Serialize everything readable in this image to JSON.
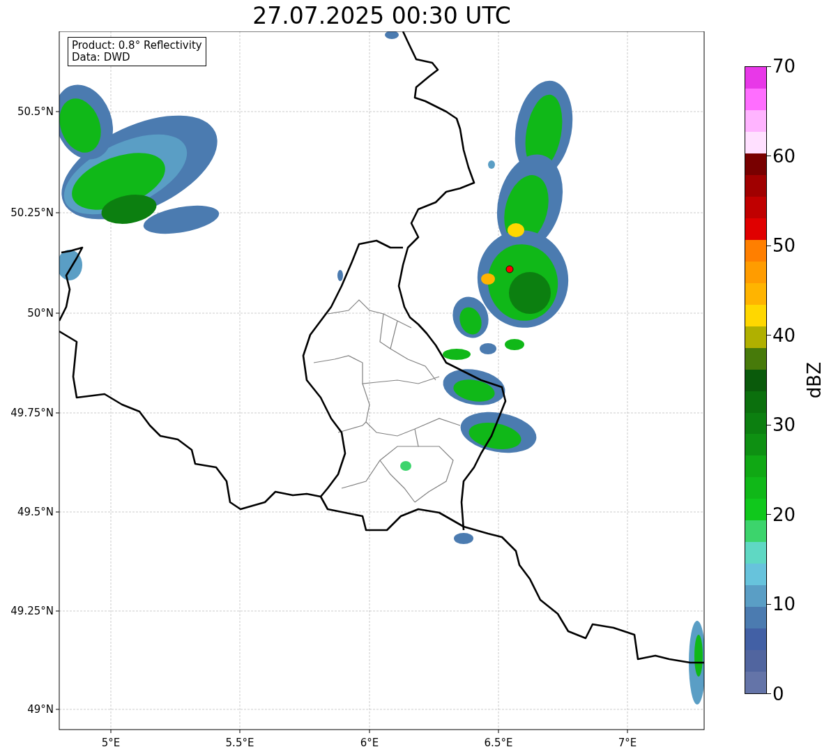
{
  "title": "27.07.2025 00:30 UTC",
  "info_box": [
    "Product: 0.8° Reflectivity",
    "Data: DWD"
  ],
  "map": {
    "x_ticks": [
      "5°E",
      "5.5°E",
      "6°E",
      "6.5°E",
      "7°E"
    ],
    "y_ticks": [
      "50.5°N",
      "50.25°N",
      "50°N",
      "49.75°N",
      "49.5°N",
      "49.25°N",
      "49°N"
    ]
  },
  "colorbar": {
    "ticks": [
      "70",
      "60",
      "50",
      "40",
      "30",
      "20",
      "10",
      "0"
    ],
    "segments": [
      {
        "color": "#e838e8"
      },
      {
        "color": "#ff6eff"
      },
      {
        "color": "#ffb4ff"
      },
      {
        "color": "#ffe0ff"
      },
      {
        "color": "#780000"
      },
      {
        "color": "#a00000"
      },
      {
        "color": "#c00000"
      },
      {
        "color": "#e00000"
      },
      {
        "color": "#ff7f00"
      },
      {
        "color": "#ff9c00"
      },
      {
        "color": "#ffb400"
      },
      {
        "color": "#ffd700"
      },
      {
        "color": "#b0b000"
      },
      {
        "color": "#477a0a"
      },
      {
        "color": "#0a5a0b"
      },
      {
        "color": "#0b700d"
      },
      {
        "color": "#0c7f10"
      },
      {
        "color": "#0e9012"
      },
      {
        "color": "#10a814"
      },
      {
        "color": "#10b818"
      },
      {
        "color": "#10c81c"
      },
      {
        "color": "#3cd46c"
      },
      {
        "color": "#5fd8c3"
      },
      {
        "color": "#67c3dc"
      },
      {
        "color": "#5a9ec5"
      },
      {
        "color": "#4b7bb0"
      },
      {
        "color": "#4260a5"
      },
      {
        "color": "#51659f"
      },
      {
        "color": "#6474a8"
      }
    ],
    "label": "dBZ"
  }
}
